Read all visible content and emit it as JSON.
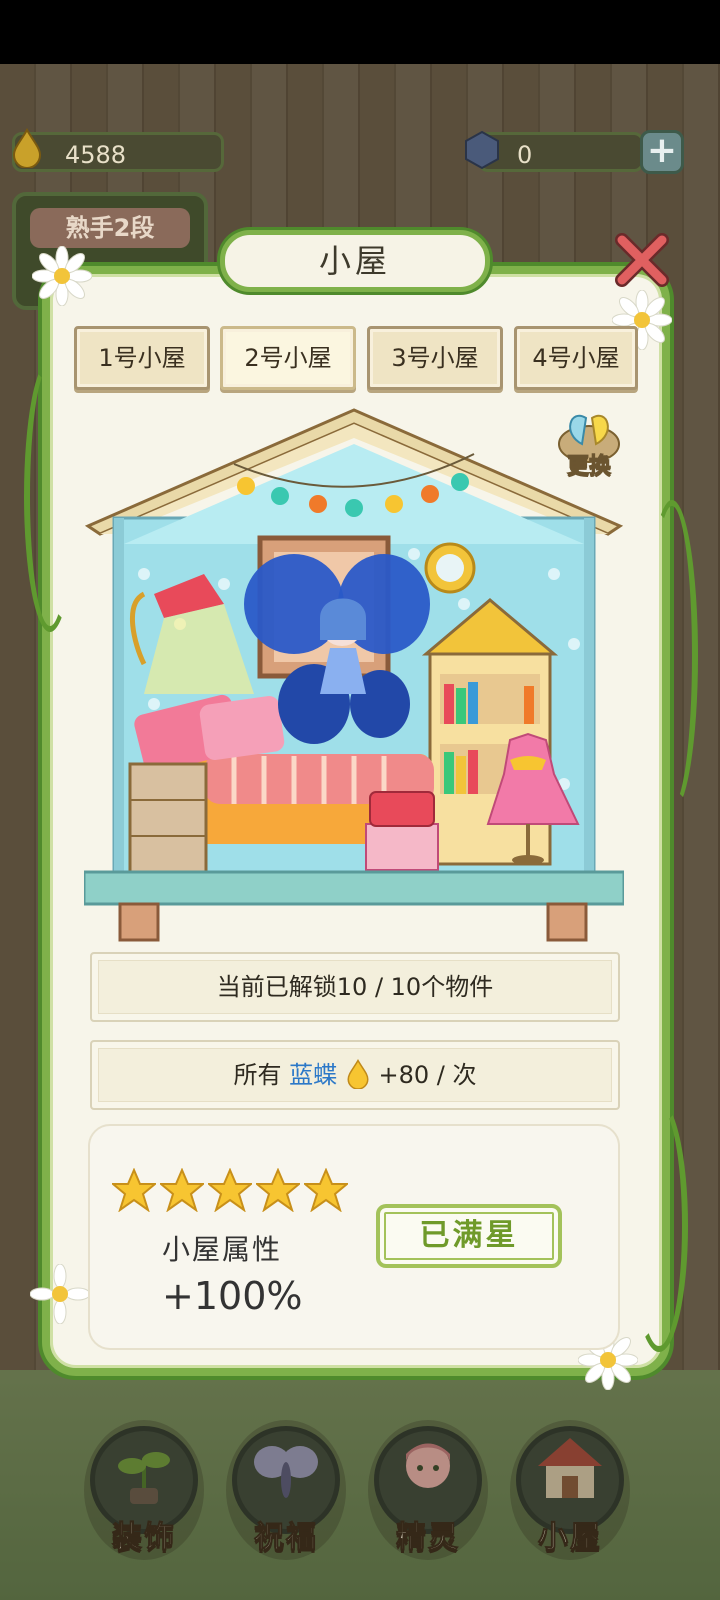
{
  "resources": {
    "drops": "4588",
    "gems": "0",
    "plus_label": "+"
  },
  "level": {
    "label": "熟手2段"
  },
  "panel": {
    "title": "小屋",
    "tabs": [
      {
        "label": "1号小屋",
        "active": false
      },
      {
        "label": "2号小屋",
        "active": true
      },
      {
        "label": "3号小屋",
        "active": false
      },
      {
        "label": "4号小屋",
        "active": false
      }
    ],
    "swap_label": "更换",
    "unlock_text": "当前已解锁10 / 10个物件",
    "bonus": {
      "prefix": "所有",
      "highlight": "蓝蝶",
      "suffix": "+80 / 次"
    },
    "stars_filled": 5,
    "attr_label": "小屋属性",
    "attr_value": "+100%",
    "max_label": "已满星"
  },
  "nav": [
    {
      "label": "装饰"
    },
    {
      "label": "祝福"
    },
    {
      "label": "精灵"
    },
    {
      "label": "小屋"
    }
  ],
  "colors": {
    "accent_green": "#7fb14a",
    "highlight_blue": "#2b78c8",
    "star_gold": "#f7c531"
  }
}
